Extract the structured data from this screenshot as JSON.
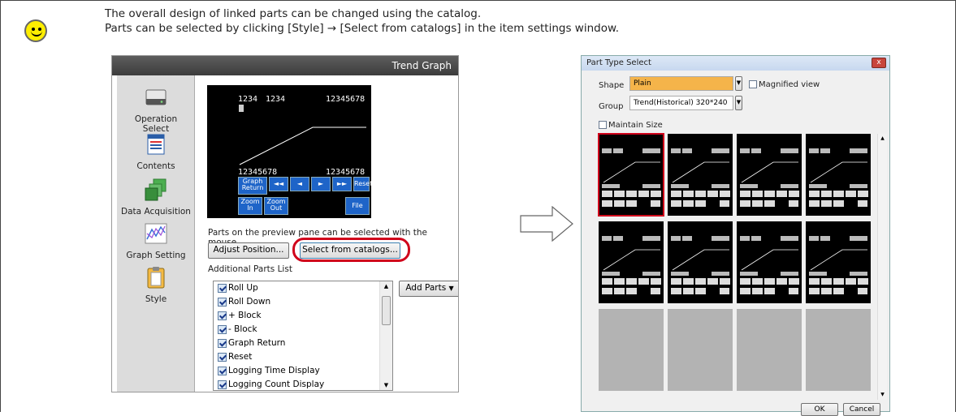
{
  "intro": {
    "line1": "The overall design of linked parts can be changed using the catalog.",
    "line2": "Parts can be selected by clicking [Style] → [Select from catalogs] in the item settings window."
  },
  "left_window": {
    "title": "Trend Graph",
    "sidebar": [
      {
        "icon": "hard-drive-icon",
        "label_line1": "Operation",
        "label_line2": "Select"
      },
      {
        "icon": "document-list-icon",
        "label_line1": "Contents",
        "label_line2": ""
      },
      {
        "icon": "stacked-squares-icon",
        "label_line1": "Data Acquisition",
        "label_line2": ""
      },
      {
        "icon": "line-graph-icon",
        "label_line1": "Graph Setting",
        "label_line2": ""
      },
      {
        "icon": "clipboard-icon",
        "label_line1": "Style",
        "label_line2": ""
      }
    ],
    "preview": {
      "top_left_1": "1234",
      "top_left_2": "1234",
      "top_right": "12345678",
      "bottom_left": "12345678",
      "bottom_right": "12345678",
      "buttons": {
        "graph_return": "Graph Return",
        "rewind_fast": "◄◄",
        "rewind": "◄",
        "forward": "►",
        "forward_fast": "►►",
        "reset": "Reset",
        "zoom_in": "Zoom In",
        "zoom_out": "Zoom Out",
        "file": "File"
      }
    },
    "hint": "Parts on the preview pane can be selected with the mouse.",
    "adjust_position": "Adjust Position...",
    "select_from_catalogs": "Select from catalogs...",
    "additional_parts_label": "Additional Parts List",
    "add_parts": "Add Parts",
    "parts_list": [
      "Roll Up",
      "Roll Down",
      "+ Block",
      "- Block",
      "Graph Return",
      "Reset",
      "Logging Time Display",
      "Logging Count Display"
    ]
  },
  "dialog": {
    "title": "Part Type Select",
    "close": "x",
    "shape_label": "Shape",
    "shape_value": "Plain",
    "magnified_view": "Magnified view",
    "group_label": "Group",
    "group_value": "Trend(Historical) 320*240",
    "maintain_size": "Maintain Size",
    "ok": "OK",
    "cancel": "Cancel"
  },
  "colors": {
    "accent_red": "#d0021b",
    "preview_button_blue": "#1e64c8",
    "shape_select_orange": "#f5b44a"
  }
}
